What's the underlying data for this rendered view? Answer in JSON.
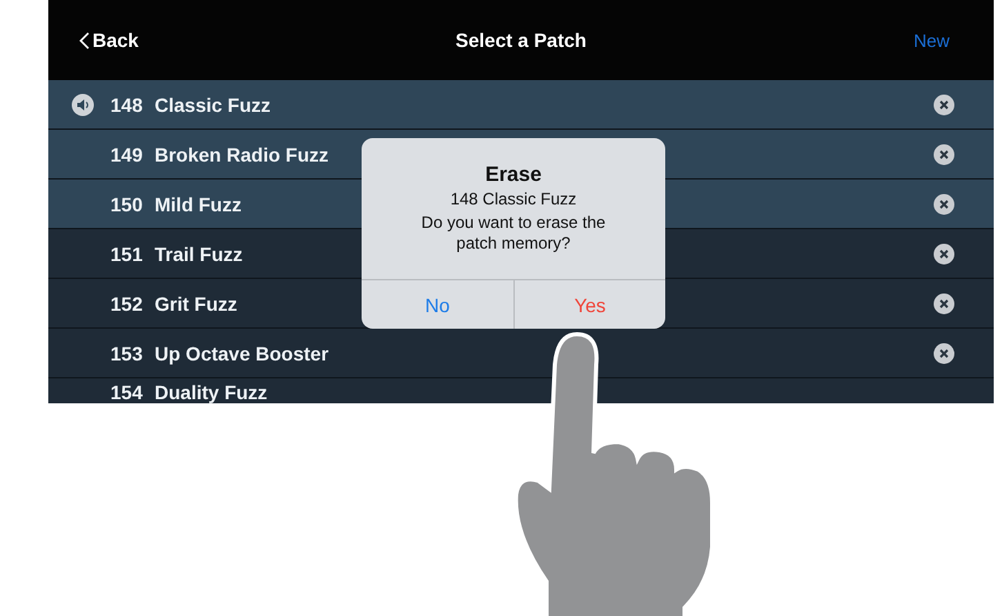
{
  "header": {
    "back": "Back",
    "title": "Select a Patch",
    "action": "New"
  },
  "patches": [
    {
      "number": "148",
      "name": "Classic Fuzz",
      "current": true,
      "highlighted": true
    },
    {
      "number": "149",
      "name": "Broken Radio Fuzz",
      "current": false,
      "highlighted": true
    },
    {
      "number": "150",
      "name": "Mild Fuzz",
      "current": false,
      "highlighted": true
    },
    {
      "number": "151",
      "name": "Trail Fuzz",
      "current": false,
      "highlighted": false
    },
    {
      "number": "152",
      "name": "Grit Fuzz",
      "current": false,
      "highlighted": false
    },
    {
      "number": "153",
      "name": "Up Octave Booster",
      "current": false,
      "highlighted": false
    },
    {
      "number": "154",
      "name": "Duality Fuzz",
      "current": false,
      "highlighted": false
    }
  ],
  "dialog": {
    "title": "Erase",
    "patch": "148 Classic Fuzz",
    "message": "Do you want to erase the patch memory?",
    "buttons": [
      {
        "label": "No",
        "kind": "cancel"
      },
      {
        "label": "Yes",
        "kind": "destructive"
      }
    ]
  }
}
